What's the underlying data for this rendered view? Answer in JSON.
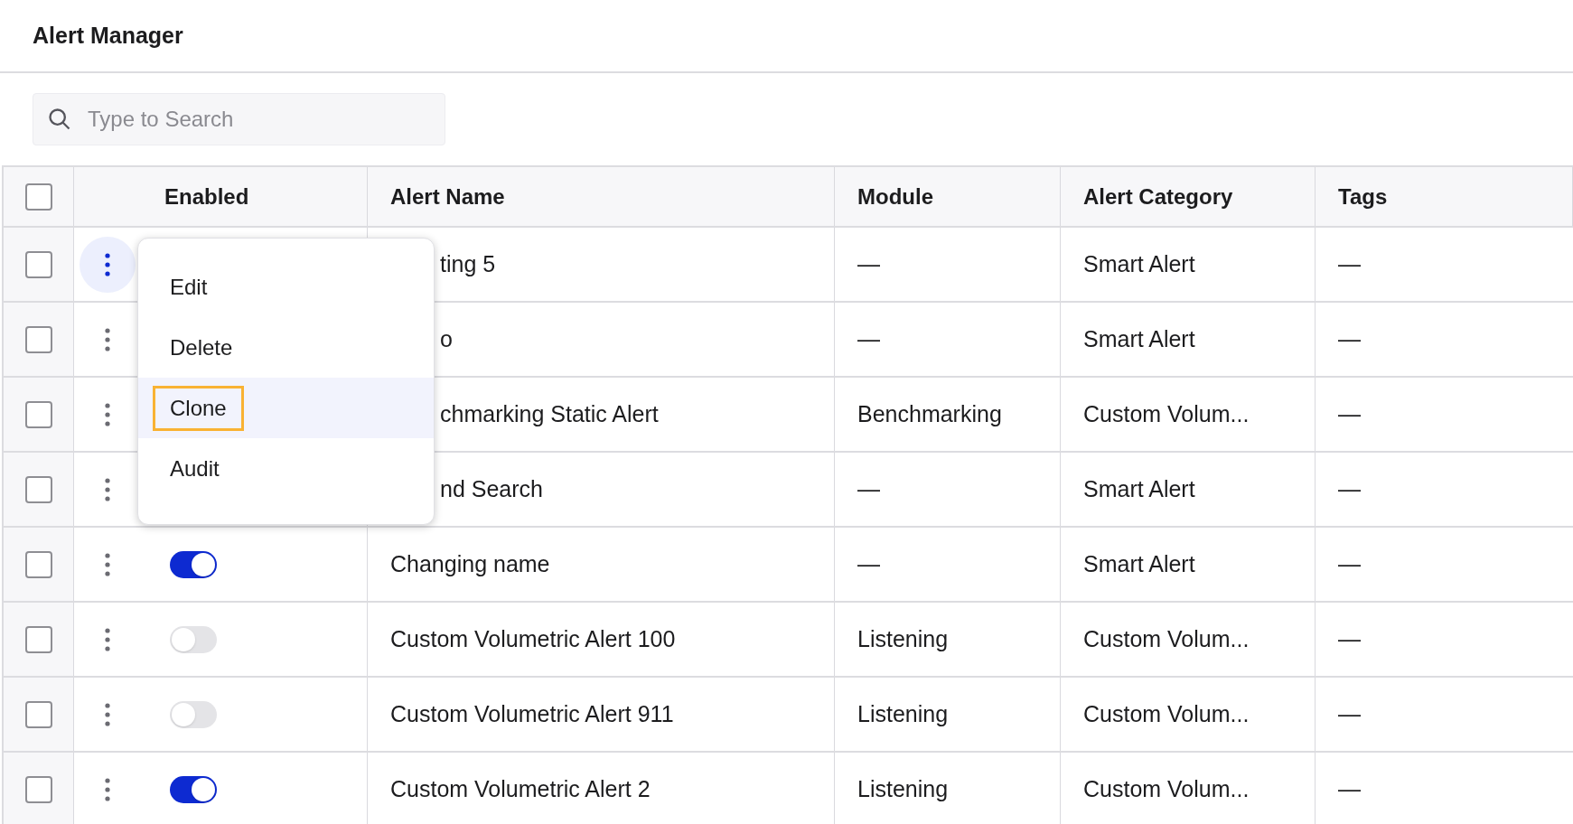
{
  "page": {
    "title": "Alert Manager"
  },
  "search": {
    "placeholder": "Type to Search"
  },
  "table": {
    "select_all": {
      "checked": false
    },
    "columns": [
      "Enabled",
      "Alert Name",
      "Module",
      "Alert Category",
      "Tags"
    ],
    "rows": [
      {
        "checked": false,
        "menu_open": true,
        "name": "ting 5",
        "module": "—",
        "category": "Smart Alert",
        "tags": "—"
      },
      {
        "checked": false,
        "menu_open": false,
        "name": "o",
        "module": "—",
        "category": "Smart Alert",
        "tags": "—"
      },
      {
        "checked": false,
        "menu_open": false,
        "name": "chmarking Static Alert",
        "module": "Benchmarking",
        "category": "Custom Volum...",
        "tags": "—"
      },
      {
        "checked": false,
        "menu_open": false,
        "name": "nd Search",
        "module": "—",
        "category": "Smart Alert",
        "tags": "—"
      },
      {
        "checked": false,
        "menu_open": false,
        "enabled": true,
        "name": "Changing name",
        "module": "—",
        "category": "Smart Alert",
        "tags": "—"
      },
      {
        "checked": false,
        "menu_open": false,
        "enabled": false,
        "name": "Custom Volumetric Alert 100",
        "module": "Listening",
        "category": "Custom Volum...",
        "tags": "—"
      },
      {
        "checked": false,
        "menu_open": false,
        "enabled": false,
        "name": "Custom Volumetric Alert 911",
        "module": "Listening",
        "category": "Custom Volum...",
        "tags": "—"
      },
      {
        "checked": false,
        "menu_open": false,
        "enabled": true,
        "name": "Custom Volumetric Alert 2",
        "module": "Listening",
        "category": "Custom Volum...",
        "tags": "—"
      }
    ]
  },
  "row_menu": {
    "items": [
      {
        "label": "Edit",
        "selected": false
      },
      {
        "label": "Delete",
        "selected": false
      },
      {
        "label": "Clone",
        "selected": true
      },
      {
        "label": "Audit",
        "selected": false
      }
    ]
  }
}
